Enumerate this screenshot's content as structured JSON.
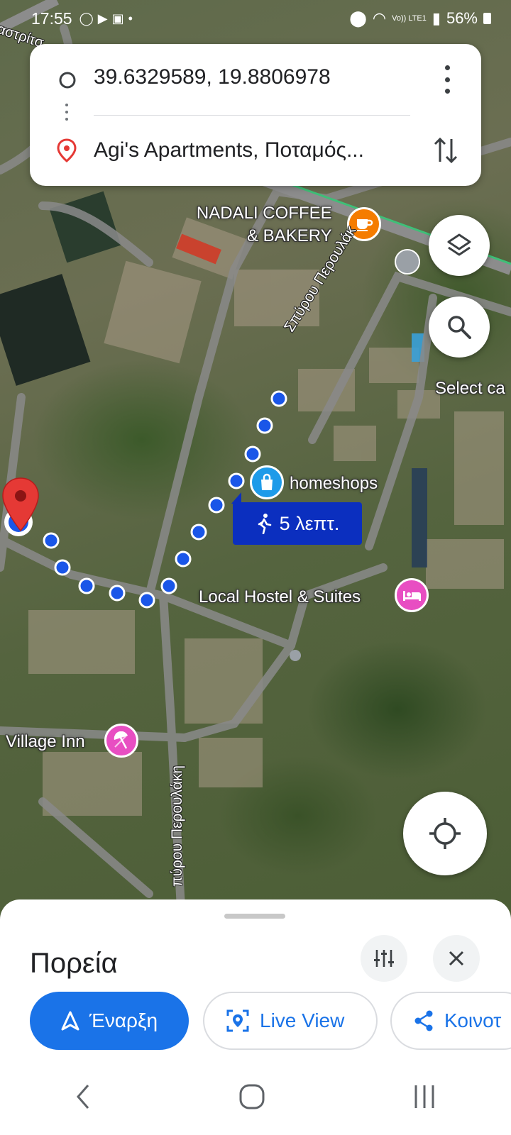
{
  "status_bar": {
    "time": "17:55",
    "battery": "56%",
    "network": "Vo)) LTE1"
  },
  "route": {
    "origin": "39.6329589, 19.8806978",
    "destination": "Agi's Apartments, Ποταμός..."
  },
  "map": {
    "places": {
      "coffee": "NADALI COFFEE & BAKERY",
      "coffee_line1": "NADALI COFFEE",
      "coffee_line2": "& BAKERY",
      "homeshops": "homeshops",
      "hostel": "Local Hostel & Suites",
      "village_inn": "Village Inn",
      "select_partial": "Select ca"
    },
    "roads": {
      "road_top_left": "αστρίτσ",
      "road_main_upper": "Σπύρου Περουλάκ",
      "road_main_lower": "πύρου Περουλάκη"
    },
    "walk_time": "5 λεπτ.",
    "colors": {
      "route_dot": "#1a56e8",
      "pin": "#e53935",
      "pink_poi": "#e84ec2",
      "orange_poi": "#f57c00",
      "blue_poi": "#1e9be9"
    }
  },
  "sheet": {
    "title": "Πορεία",
    "start_label": "Έναρξη",
    "live_view_label": "Live View",
    "share_label": "Κοινοτ"
  },
  "icons": [
    "layers-icon",
    "search-icon",
    "my-location-icon",
    "tune-icon",
    "close-icon",
    "navigation-icon",
    "live-view-icon",
    "share-icon",
    "back-icon",
    "home-icon",
    "recents-icon"
  ]
}
